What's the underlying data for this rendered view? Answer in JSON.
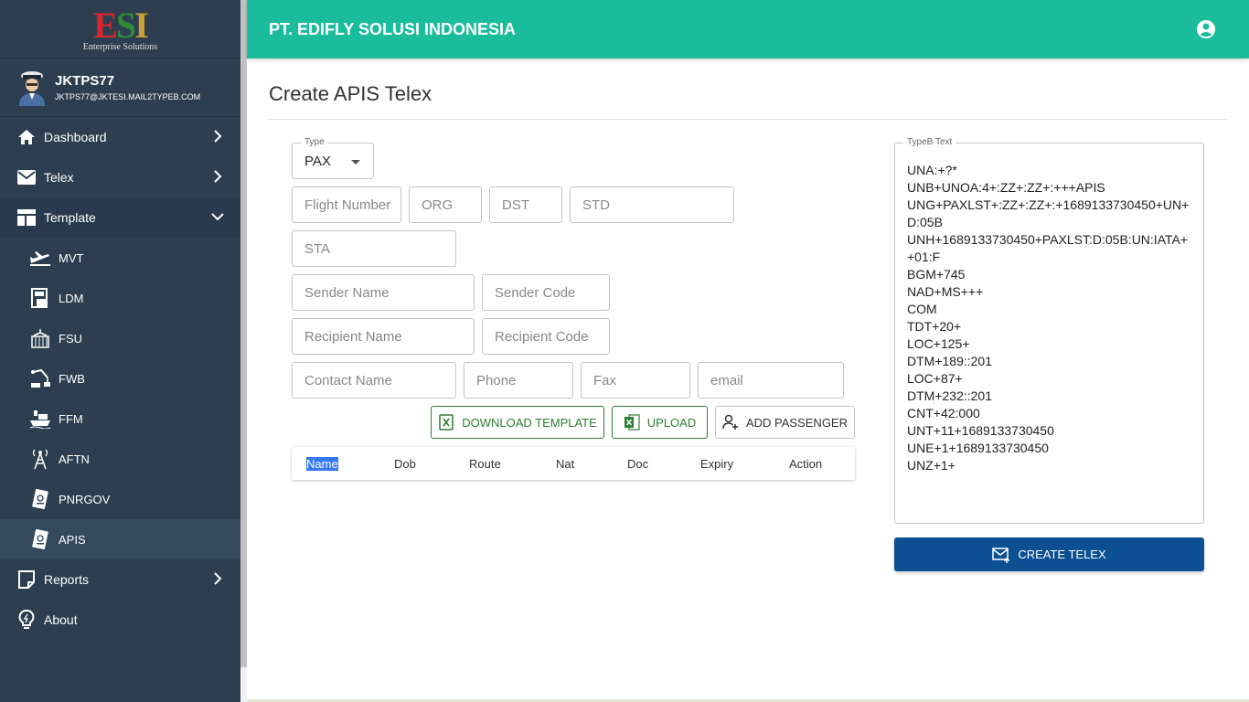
{
  "brand": {
    "logo_text": "ESI",
    "logo_sub": "Enterprise Solutions"
  },
  "user": {
    "name": "JKTPS77",
    "email": "JKTPS77@JKTESI.MAIL2TYPEB.COM"
  },
  "nav": {
    "dashboard": "Dashboard",
    "telex": "Telex",
    "template": "Template",
    "template_items": [
      "MVT",
      "LDM",
      "FSU",
      "FWB",
      "FFM",
      "AFTN",
      "PNRGOV",
      "APIS"
    ],
    "reports": "Reports",
    "about": "About"
  },
  "header": {
    "title": "PT. EDIFLY SOLUSI INDONESIA"
  },
  "page": {
    "title": "Create APIS Telex"
  },
  "form": {
    "type_label": "Type",
    "type_value": "PAX",
    "flight_number": "Flight Number",
    "org": "ORG",
    "dst": "DST",
    "std": "STD",
    "sta": "STA",
    "sender_name": "Sender Name",
    "sender_code": "Sender Code",
    "recipient_name": "Recipient Name",
    "recipient_code": "Recipient Code",
    "contact_name": "Contact Name",
    "phone": "Phone",
    "fax": "Fax",
    "email": "email"
  },
  "buttons": {
    "download_template": "DOWNLOAD TEMPLATE",
    "upload": "UPLOAD",
    "add_passenger": "ADD PASSENGER",
    "create_telex": "CREATE TELEX"
  },
  "table": {
    "columns": [
      "Name",
      "Dob",
      "Route",
      "Nat",
      "Doc",
      "Expiry",
      "Action"
    ]
  },
  "typeb": {
    "label": "TypeB Text",
    "lines": [
      "UNA:+?*",
      "UNB+UNOA:4+:ZZ+:ZZ+:+++APIS",
      "UNG+PAXLST+:ZZ+:ZZ+:+1689133730450+UN+",
      "D:05B",
      "UNH+1689133730450+PAXLST:D:05B:UN:IATA+",
      "+01:F",
      "BGM+745",
      "NAD+MS+++",
      "COM",
      "TDT+20+",
      "LOC+125+",
      "DTM+189::201",
      "LOC+87+",
      "DTM+232::201",
      "CNT+42:000",
      "UNT+11+1689133730450",
      "UNE+1+1689133730450",
      "UNZ+1+"
    ]
  },
  "colors": {
    "header": "#1abc9c",
    "sidebar": "#2c3e50",
    "primary_button": "#0c4f92",
    "outline_green": "#2e7d32"
  }
}
